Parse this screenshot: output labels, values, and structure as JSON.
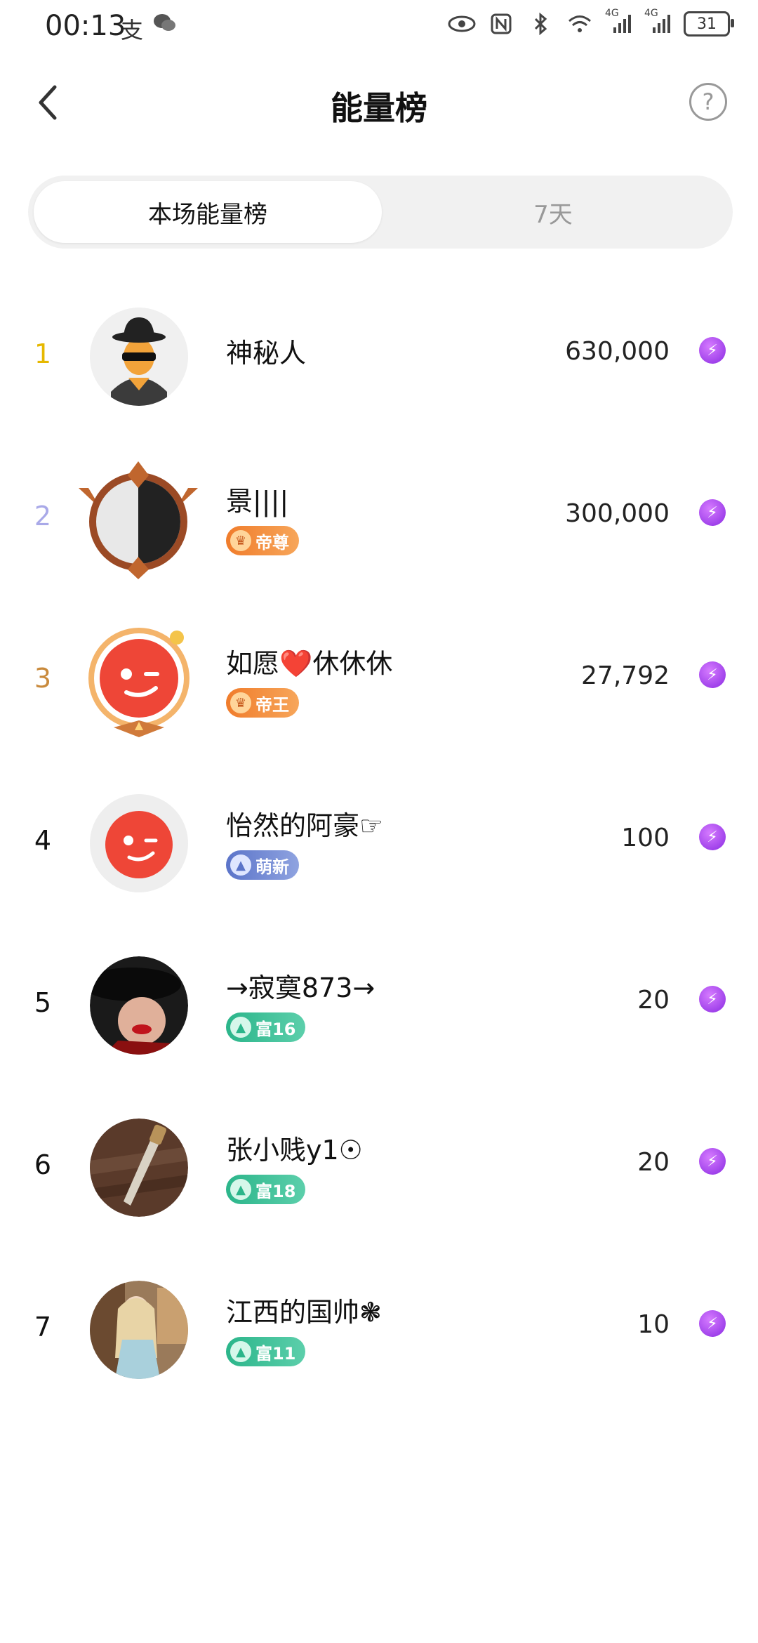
{
  "status": {
    "time": "00:13",
    "battery": "31",
    "net1": "4G",
    "net2": "4G"
  },
  "header": {
    "title": "能量榜",
    "help": "?"
  },
  "tabs": [
    {
      "label": "本场能量榜"
    },
    {
      "label": "7天"
    }
  ],
  "colors": {
    "rank1": "#e6b800",
    "rank2": "#a9a9e8",
    "rank3": "#c98a3c",
    "energy": "#9b3fe0"
  },
  "rows": [
    {
      "rank": "1",
      "name": "神秘人",
      "badge": "",
      "score": "630,000"
    },
    {
      "rank": "2",
      "name": "景||||",
      "badge": "帝尊",
      "score": "300,000"
    },
    {
      "rank": "3",
      "name": "如愿❤️休休休",
      "badge": "帝王",
      "score": "27,792"
    },
    {
      "rank": "4",
      "name": "怡然的阿豪☞",
      "badge": "萌新",
      "score": "100"
    },
    {
      "rank": "5",
      "name": "→寂寞873→",
      "badge": "富16",
      "score": "20"
    },
    {
      "rank": "6",
      "name": "张小贱y1☉",
      "badge": "富18",
      "score": "20"
    },
    {
      "rank": "7",
      "name": "江西的国帅❃",
      "badge": "富11",
      "score": "10"
    }
  ]
}
